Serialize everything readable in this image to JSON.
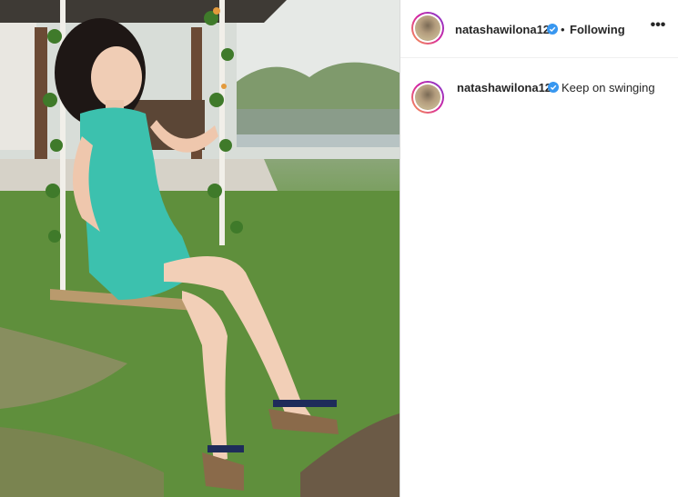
{
  "post": {
    "username": "natashawilona12",
    "follow_status": "Following",
    "separator": "•",
    "more_label": "•••",
    "caption": "Keep on swinging"
  },
  "colors": {
    "text": "#262626",
    "verified_blue": "#3897f0",
    "divider": "#dbdbdb"
  },
  "icons": {
    "verified": "verified-badge-icon",
    "more": "more-options-icon"
  }
}
